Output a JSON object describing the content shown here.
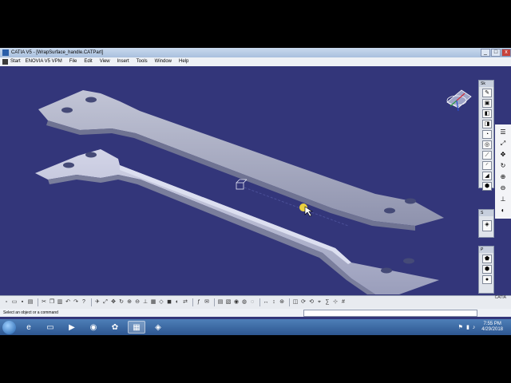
{
  "window": {
    "title": "CATIA V5 - [WrapSurface_handle.CATPart]",
    "minimize": "_",
    "maximize": "□",
    "close": "x"
  },
  "menu": {
    "items": [
      {
        "label": "Start"
      },
      {
        "label": "ENOVIA V5 VPM"
      },
      {
        "label": "File"
      },
      {
        "label": "Edit"
      },
      {
        "label": "View"
      },
      {
        "label": "Insert"
      },
      {
        "label": "Tools"
      },
      {
        "label": "Window"
      },
      {
        "label": "Help"
      }
    ]
  },
  "workbench": {
    "toolbar_header": "Sk",
    "second_header": "S",
    "third_header": "P"
  },
  "status": {
    "message": "Select an object or a command",
    "brand": "CATIA"
  },
  "taskbar": {
    "time": "7:55 PM",
    "date": "4/29/2018"
  },
  "colors": {
    "viewport_bg": "#33367a",
    "part_fill": "#a9adc4",
    "accent": "#c8413a"
  }
}
